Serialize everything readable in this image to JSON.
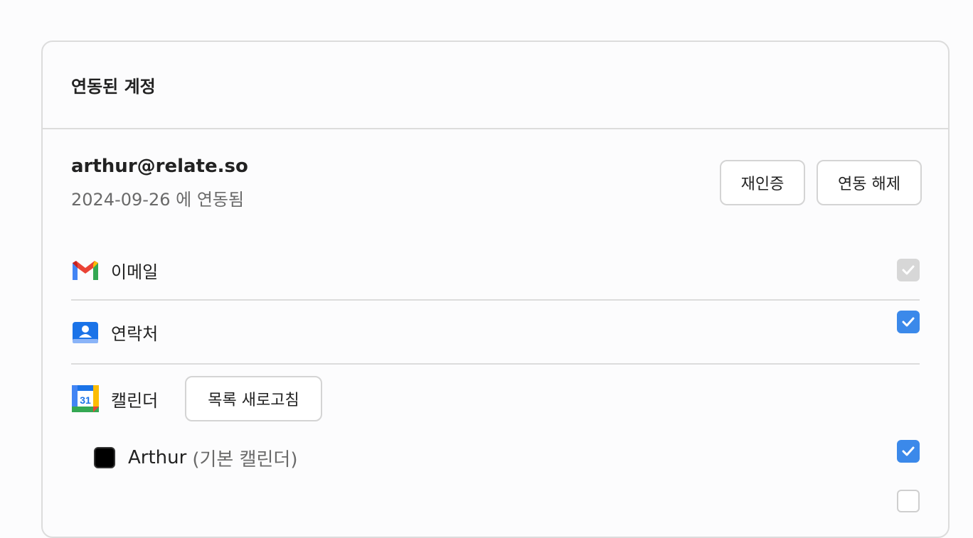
{
  "card": {
    "title": "연동된 계정"
  },
  "account": {
    "email": "arthur@relate.so",
    "linked_text": "2024-09-26 에 연동됨",
    "reauth_label": "재인증",
    "unlink_label": "연동 해제"
  },
  "services": {
    "email": {
      "label": "이메일",
      "checked": true,
      "disabled": true
    },
    "contacts": {
      "label": "연락처",
      "checked": true
    },
    "calendar": {
      "label": "캘린더",
      "refresh_label": "목록 새로고침",
      "calendar_day": "31"
    }
  },
  "calendars": [
    {
      "name": "Arthur",
      "suffix": "(기본 캘린더)",
      "color": "#000000",
      "checked": true
    }
  ],
  "colors": {
    "accent": "#3b89ea",
    "border": "#dcdcdc"
  }
}
